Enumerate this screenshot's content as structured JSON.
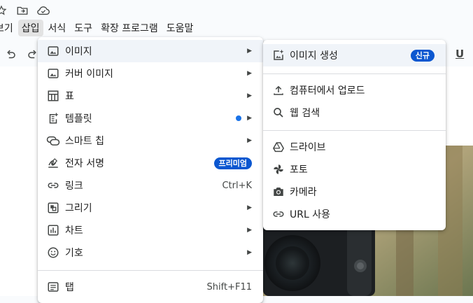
{
  "menubar": {
    "items": [
      {
        "label": "보기"
      },
      {
        "label": "삽입"
      },
      {
        "label": "서식"
      },
      {
        "label": "도구"
      },
      {
        "label": "확장 프로그램"
      },
      {
        "label": "도움말"
      }
    ],
    "active_index": 1
  },
  "toolbar": {
    "underline_label": "U"
  },
  "insert_menu": {
    "items": [
      {
        "label": "이미지",
        "icon": "image-icon",
        "has_submenu": true
      },
      {
        "label": "커버 이미지",
        "icon": "cover-image-icon",
        "has_submenu": true
      },
      {
        "label": "표",
        "icon": "table-icon",
        "has_submenu": true
      },
      {
        "label": "템플릿",
        "icon": "template-icon",
        "has_submenu": true,
        "new_dot": true
      },
      {
        "label": "스마트 칩",
        "icon": "smart-chip-icon",
        "has_submenu": true
      },
      {
        "label": "전자 서명",
        "icon": "signature-icon",
        "badge": "프리미엄"
      },
      {
        "label": "링크",
        "icon": "link-icon",
        "shortcut": "Ctrl+K"
      },
      {
        "label": "그리기",
        "icon": "drawing-icon",
        "has_submenu": true
      },
      {
        "label": "차트",
        "icon": "chart-icon",
        "has_submenu": true
      },
      {
        "label": "기호",
        "icon": "emoji-icon",
        "has_submenu": true
      },
      {
        "label": "탭",
        "icon": "tab-icon",
        "shortcut": "Shift+F11"
      }
    ]
  },
  "image_submenu": {
    "items": [
      {
        "label": "이미지 생성",
        "icon": "generate-image-icon",
        "badge": "신규"
      },
      {
        "label": "컴퓨터에서 업로드",
        "icon": "upload-icon"
      },
      {
        "label": "웹 검색",
        "icon": "search-icon"
      },
      {
        "label": "드라이브",
        "icon": "drive-icon"
      },
      {
        "label": "포토",
        "icon": "photos-icon"
      },
      {
        "label": "카메라",
        "icon": "camera-icon"
      },
      {
        "label": "URL 사용",
        "icon": "link-icon"
      }
    ]
  },
  "colors": {
    "accent": "#0b57d0",
    "hover": "#f0f4f9",
    "menubar_active": "#e3e3e3"
  }
}
